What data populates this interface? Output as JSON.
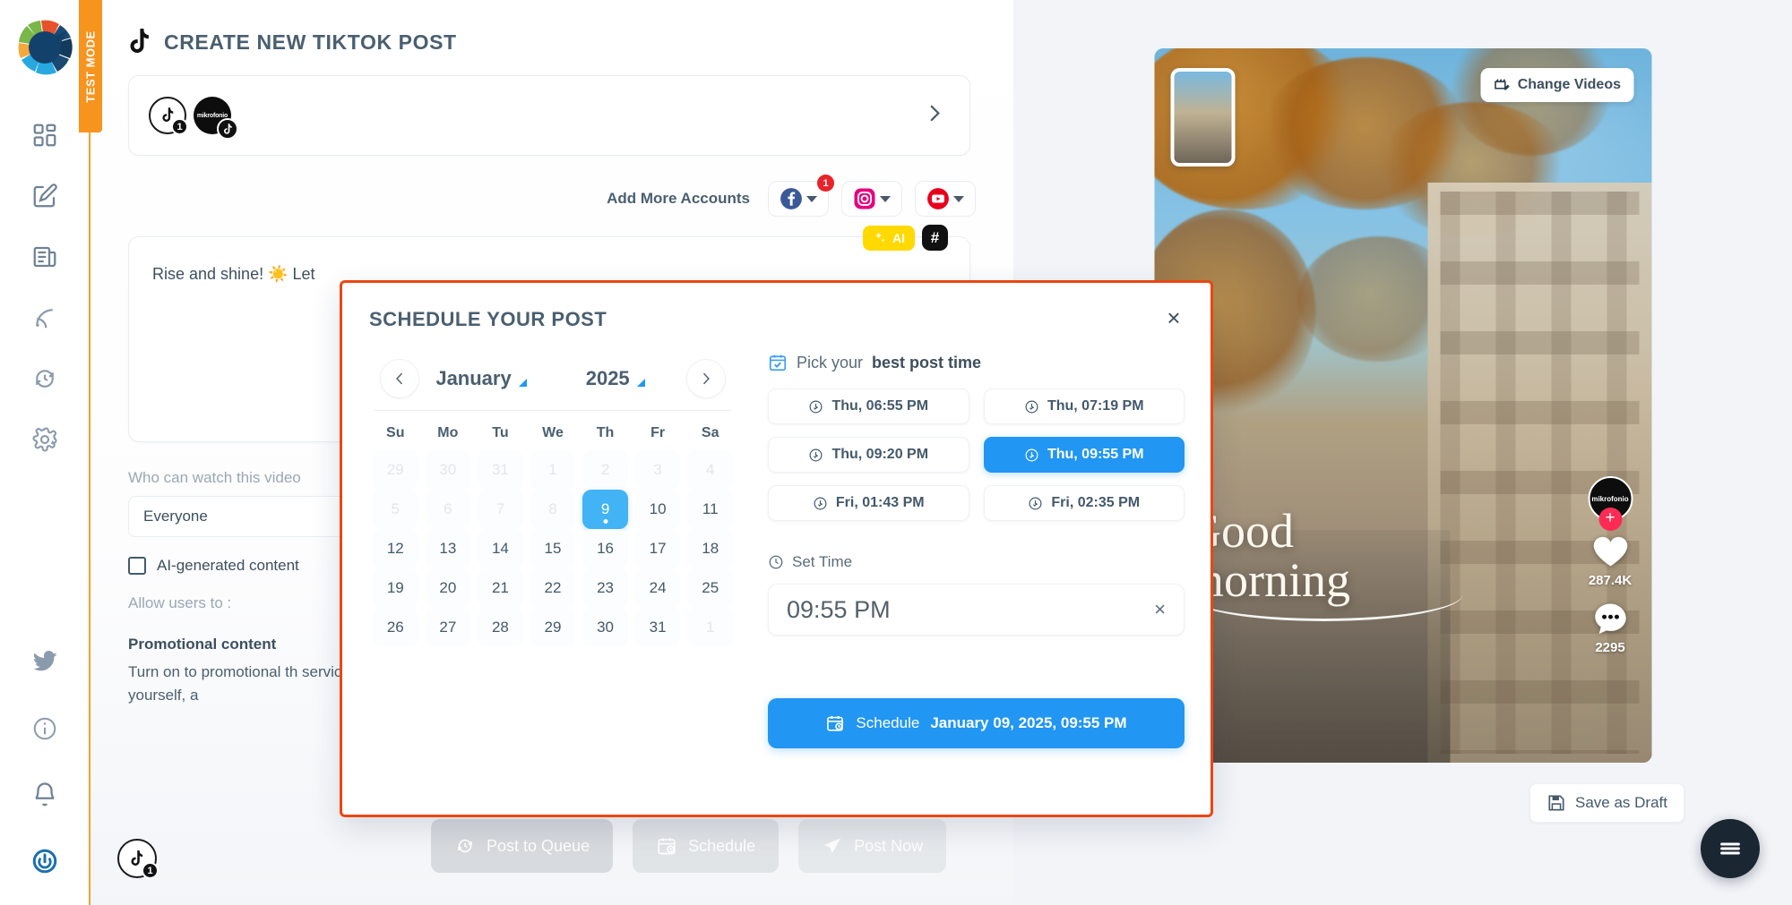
{
  "sidebar": {
    "test_mode_label": "TEST MODE",
    "logo_name": "app-logo",
    "items": [
      {
        "name": "dashboard",
        "icon": "grid-icon"
      },
      {
        "name": "compose",
        "icon": "edit-square-icon"
      },
      {
        "name": "content",
        "icon": "newspaper-icon"
      },
      {
        "name": "feeds",
        "icon": "rss-icon"
      },
      {
        "name": "queue",
        "icon": "clock-refresh-icon"
      },
      {
        "name": "settings",
        "icon": "gear-icon"
      }
    ],
    "bottom_items": [
      {
        "name": "twitter",
        "icon": "twitter-bird-icon"
      },
      {
        "name": "info",
        "icon": "info-circle-icon"
      },
      {
        "name": "notifications",
        "icon": "bell-icon"
      },
      {
        "name": "power",
        "icon": "power-icon"
      }
    ]
  },
  "editor": {
    "page_title": "CREATE NEW TIKTOK POST",
    "account_badge_count": "1",
    "account_brand_label": "mikrofonio",
    "add_accounts": {
      "label": "Add More Accounts",
      "facebook_badge": "1",
      "networks": [
        "facebook",
        "instagram",
        "youtube"
      ]
    },
    "compose": {
      "ai_label": "AI",
      "hashtag_label": "#",
      "text": "Rise and shine! ☀️  Let"
    },
    "privacy": {
      "label": "Who can watch this video",
      "value": "Everyone"
    },
    "ai_content": {
      "label": "AI-generated content",
      "checked": false
    },
    "allow_users": {
      "label": "Allow users to :",
      "checked": true
    },
    "promotional": {
      "title": "Promotional content",
      "body": "Turn on to promotional th services in exchange for s could promote yourself, a"
    },
    "actions": [
      {
        "label": "Post to Queue",
        "icon": "queue-clock-icon"
      },
      {
        "label": "Schedule",
        "icon": "calendar-clock-icon"
      },
      {
        "label": "Post Now",
        "icon": "send-icon"
      }
    ]
  },
  "preview": {
    "change_videos_label": "Change Videos",
    "overlay_text_line1": "Good",
    "overlay_text_line2": "morning",
    "brand_handle": "mikrofonio",
    "likes": "287.4K",
    "comments": "2295",
    "save_draft_label": "Save as Draft",
    "menu_icon": "hamburger-icon"
  },
  "modal": {
    "title": "SCHEDULE YOUR POST",
    "close_label": "×",
    "calendar": {
      "prev_label": "‹",
      "next_label": "›",
      "month": "January",
      "year": "2025",
      "dow": [
        "Su",
        "Mo",
        "Tu",
        "We",
        "Th",
        "Fr",
        "Sa"
      ],
      "weeks": [
        [
          {
            "d": "29",
            "state": "muted"
          },
          {
            "d": "30",
            "state": "muted"
          },
          {
            "d": "31",
            "state": "muted"
          },
          {
            "d": "1",
            "state": "muted"
          },
          {
            "d": "2",
            "state": "muted"
          },
          {
            "d": "3",
            "state": "muted"
          },
          {
            "d": "4",
            "state": "muted"
          }
        ],
        [
          {
            "d": "5",
            "state": "muted"
          },
          {
            "d": "6",
            "state": "muted"
          },
          {
            "d": "7",
            "state": "muted"
          },
          {
            "d": "8",
            "state": "muted"
          },
          {
            "d": "9",
            "state": "selected"
          },
          {
            "d": "10",
            "state": "normal"
          },
          {
            "d": "11",
            "state": "normal"
          }
        ],
        [
          {
            "d": "12",
            "state": "normal"
          },
          {
            "d": "13",
            "state": "normal"
          },
          {
            "d": "14",
            "state": "normal"
          },
          {
            "d": "15",
            "state": "normal"
          },
          {
            "d": "16",
            "state": "normal"
          },
          {
            "d": "17",
            "state": "normal"
          },
          {
            "d": "18",
            "state": "normal"
          }
        ],
        [
          {
            "d": "19",
            "state": "normal"
          },
          {
            "d": "20",
            "state": "normal"
          },
          {
            "d": "21",
            "state": "normal"
          },
          {
            "d": "22",
            "state": "normal"
          },
          {
            "d": "23",
            "state": "normal"
          },
          {
            "d": "24",
            "state": "normal"
          },
          {
            "d": "25",
            "state": "normal"
          }
        ],
        [
          {
            "d": "26",
            "state": "normal"
          },
          {
            "d": "27",
            "state": "normal"
          },
          {
            "d": "28",
            "state": "normal"
          },
          {
            "d": "29",
            "state": "normal"
          },
          {
            "d": "30",
            "state": "normal"
          },
          {
            "d": "31",
            "state": "normal"
          },
          {
            "d": "1",
            "state": "muted"
          }
        ]
      ]
    },
    "best_time": {
      "prefix": "Pick your ",
      "emphasis": "best post time",
      "slots": [
        {
          "label": "Thu, 06:55 PM",
          "active": false
        },
        {
          "label": "Thu, 07:19 PM",
          "active": false
        },
        {
          "label": "Thu, 09:20 PM",
          "active": false
        },
        {
          "label": "Thu, 09:55 PM",
          "active": true
        },
        {
          "label": "Fri, 01:43 PM",
          "active": false
        },
        {
          "label": "Fri, 02:35 PM",
          "active": false
        }
      ]
    },
    "set_time": {
      "label": "Set Time",
      "value": "09:55 PM",
      "clear_label": "×"
    },
    "schedule_button": {
      "label": "Schedule",
      "datetime": "January 09, 2025, 09:55 PM"
    }
  },
  "colors": {
    "accent_blue": "#2196f3",
    "modal_border": "#ea4713",
    "test_mode_orange": "#f7941e",
    "text_dark": "#44596b",
    "ai_yellow": "#ffd900",
    "tiktok_red": "#fe2c55"
  }
}
